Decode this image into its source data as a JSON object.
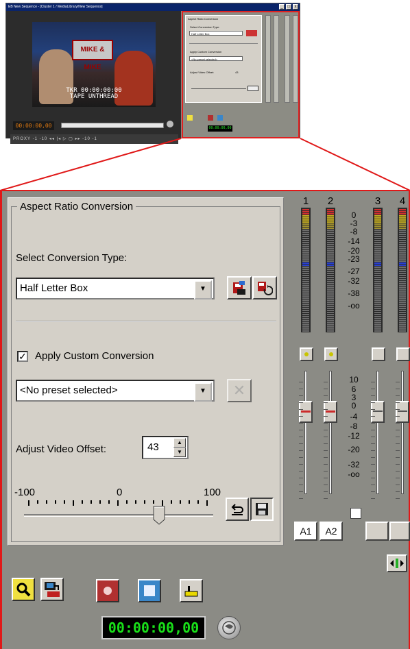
{
  "thumbnail": {
    "window_title": "EB New Sequence - [Cluster 1 / MediaLibrary/New Sequence]",
    "titlebar_buttons": [
      "_",
      "□",
      "x"
    ],
    "broadcast_banner": "MIKE & MIKE",
    "overlay_line1": "TKR 00:00:00:00",
    "overlay_line2": "TAPE UNTHREAD",
    "timecode": "00:00:00,00",
    "transport_text": "PROXY  -1  -10  ◂◂  |◂  ▷  ▢  ▸▸  -10  -1",
    "panel_title": "Aspect Ratio Conversion",
    "panel_select_label": "Select Conversion Type:",
    "panel_select_value": "Half Letter Box",
    "panel_apply": "Apply Custom Conversion",
    "panel_preset": "<No preset selected>",
    "panel_offset": "Adjust Video Offset:",
    "panel_offset_value": "43",
    "panel_timecode": "00:00:00,00"
  },
  "aspect": {
    "title": "Aspect Ratio Conversion",
    "select_label": "Select Conversion Type:",
    "conversion_type": "Half Letter Box",
    "apply_custom_label": "Apply Custom Conversion",
    "apply_custom_checked": "✓",
    "preset_value": "<No preset selected>",
    "offset_label": "Adjust Video Offset:",
    "offset_value": "43",
    "slider_min": "-100",
    "slider_mid": "0",
    "slider_max": "100",
    "slider_value_fraction": 0.715
  },
  "mixer": {
    "channels": [
      "1",
      "2",
      "3",
      "4"
    ],
    "meter_scale": [
      "0",
      "-3",
      "-8",
      "-14",
      "-20",
      "-23",
      "-27",
      "-32",
      "-38",
      "-oo"
    ],
    "fader_scale": [
      "10",
      "6",
      "3",
      "0",
      "-4",
      "-8",
      "-12",
      "-20",
      "-32",
      "-oo"
    ],
    "track_buttons": [
      "A1",
      "A2",
      "",
      ""
    ]
  },
  "bottom": {
    "timecode": "00:00:00,00"
  },
  "colors": {
    "highlight_red": "#e01818",
    "timecode_green": "#19e019",
    "record_red": "#b03030",
    "stop_blue": "#3a86c8",
    "zoom_yellow": "#f0e040"
  }
}
